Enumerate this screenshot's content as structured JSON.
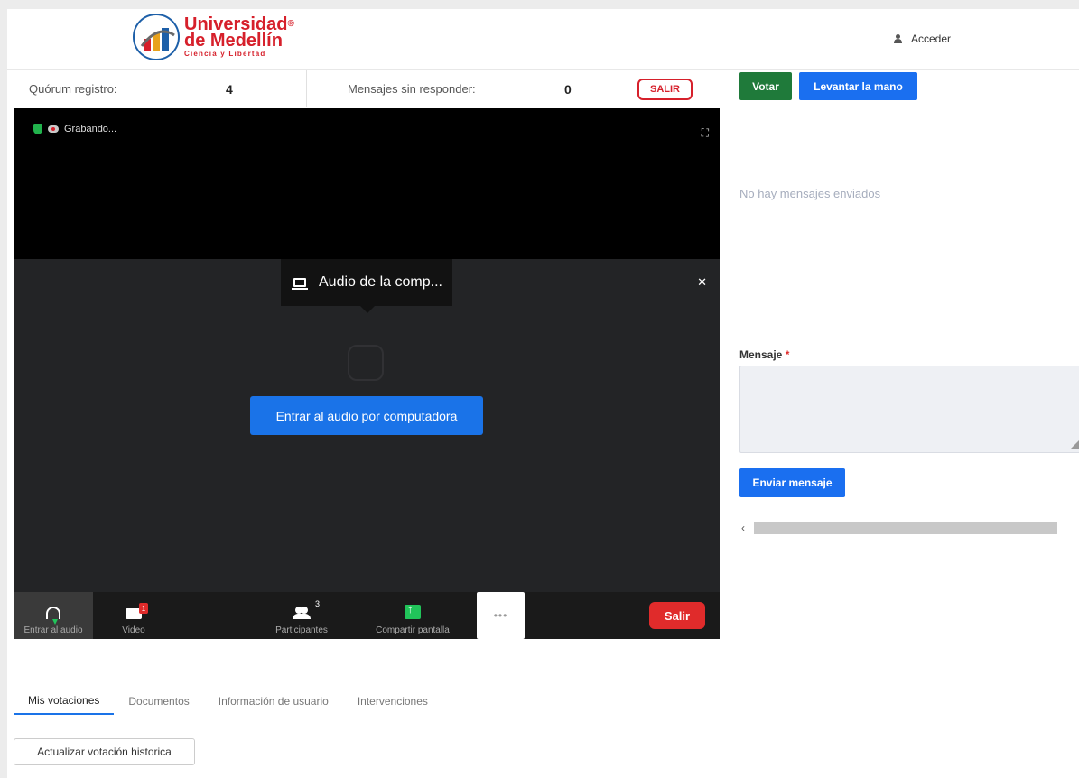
{
  "header": {
    "logo": {
      "line1": "Universidad",
      "registered": "®",
      "line2": "de Medellín",
      "tagline": "Ciencia y Libertad"
    },
    "login_label": "Acceder",
    "login_icon": "user-icon"
  },
  "stats": {
    "quorum_label": "Quórum registro:",
    "quorum_value": "4",
    "unanswered_label": "Mensajes sin responder:",
    "unanswered_value": "0",
    "exit_label": "SALIR"
  },
  "meeting": {
    "recording_label": "Grabando...",
    "audio_tooltip": "Audio de la comp...",
    "join_audio_button": "Entrar al audio por computadora",
    "toolbar": {
      "join_audio": "Entrar al audio",
      "video": "Video",
      "participants": "Participantes",
      "participants_count": "3",
      "share_screen": "Compartir pantalla",
      "more": "•••",
      "leave": "Salir"
    }
  },
  "side_panel": {
    "vote_button": "Votar",
    "raise_hand_button": "Levantar la mano",
    "empty_messages": "No hay mensajes enviados",
    "message_label": "Mensaje",
    "required_mark": "*",
    "send_button": "Enviar mensaje"
  },
  "tabs": [
    {
      "label": "Mis votaciones",
      "active": true
    },
    {
      "label": "Documentos",
      "active": false
    },
    {
      "label": "Información de usuario",
      "active": false
    },
    {
      "label": "Intervenciones",
      "active": false
    }
  ],
  "refresh_history_button": "Actualizar votación historica",
  "colors": {
    "brand_red": "#d6202b",
    "primary_blue": "#1a6ff0",
    "vote_green": "#1f7a3a",
    "tab_underline": "#1a73e8"
  }
}
